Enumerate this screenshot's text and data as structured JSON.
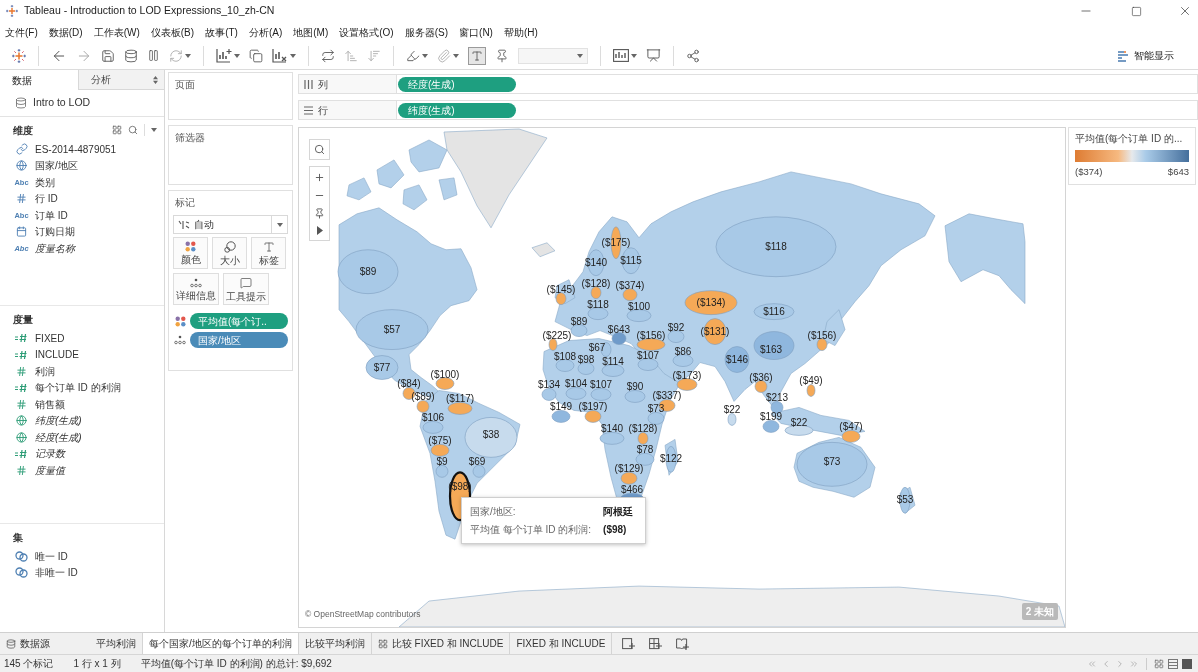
{
  "window": {
    "title": "Tableau - Introduction to LOD Expressions_10_zh-CN"
  },
  "menu": [
    "文件(F)",
    "数据(D)",
    "工作表(W)",
    "仪表板(B)",
    "故事(T)",
    "分析(A)",
    "地图(M)",
    "设置格式(O)",
    "服务器(S)",
    "窗口(N)",
    "帮助(H)"
  ],
  "toolbar": {
    "mark_labels_on": true,
    "show_me": "智能显示"
  },
  "data_pane": {
    "tabs": [
      {
        "label": "数据",
        "selected": true
      },
      {
        "label": "分析",
        "selected": false
      }
    ],
    "source": "Intro to LOD",
    "sections": [
      {
        "title": "维度",
        "kind": "dimension",
        "fields": [
          {
            "name": "ES-2014-4879051",
            "kind": "group",
            "generated": false
          },
          {
            "name": "国家/地区",
            "kind": "geo",
            "generated": false
          },
          {
            "name": "类别",
            "kind": "string",
            "icon_text": "Abc",
            "generated": false
          },
          {
            "name": "行 ID",
            "kind": "number",
            "generated": false
          },
          {
            "name": "订单 ID",
            "kind": "string",
            "icon_text": "Abc",
            "generated": false
          },
          {
            "name": "订购日期",
            "kind": "date",
            "generated": false
          },
          {
            "name": "度量名称",
            "kind": "string",
            "icon_text": "Abc",
            "generated": true
          }
        ]
      },
      {
        "title": "度量",
        "kind": "measure",
        "fields": [
          {
            "name": "FIXED",
            "kind": "calc",
            "generated": false
          },
          {
            "name": "INCLUDE",
            "kind": "calc",
            "generated": false
          },
          {
            "name": "利润",
            "kind": "number",
            "generated": false
          },
          {
            "name": "每个订单 ID 的利润",
            "kind": "calc",
            "generated": false
          },
          {
            "name": "销售额",
            "kind": "number",
            "generated": false
          },
          {
            "name": "纬度(生成)",
            "kind": "geo",
            "generated": true
          },
          {
            "name": "经度(生成)",
            "kind": "geo",
            "generated": true
          },
          {
            "name": "记录数",
            "kind": "calc",
            "generated": true
          },
          {
            "name": "度量值",
            "kind": "number",
            "generated": true
          }
        ]
      },
      {
        "title": "集",
        "kind": "set",
        "fields": [
          {
            "name": "唯一 ID",
            "kind": "set",
            "generated": false
          },
          {
            "name": "非唯一 ID",
            "kind": "set",
            "generated": false
          }
        ]
      }
    ]
  },
  "cards": {
    "pages": {
      "title": "页面"
    },
    "filters": {
      "title": "筛选器"
    },
    "marks": {
      "title": "标记",
      "mark_type": "自动",
      "properties": [
        {
          "label": "颜色",
          "kind": "color"
        },
        {
          "label": "大小",
          "kind": "size"
        },
        {
          "label": "标签",
          "kind": "label"
        },
        {
          "label": "详细信息",
          "kind": "detail"
        },
        {
          "label": "工具提示",
          "kind": "tooltip"
        }
      ],
      "pills": [
        {
          "label": "平均值(每个订..",
          "kind": "color",
          "color": "#1e9f80"
        },
        {
          "label": "国家/地区",
          "kind": "detail",
          "color": "#4a8bb8"
        }
      ]
    }
  },
  "shelves": [
    {
      "label": "列",
      "kind": "columns",
      "pill": {
        "label": "经度(生成)",
        "color": "#1e9f80"
      }
    },
    {
      "label": "行",
      "kind": "rows",
      "pill": {
        "label": "纬度(生成)",
        "color": "#1e9f80"
      }
    }
  ],
  "map": {
    "regions": [
      {
        "kind": "americas",
        "labels": [
          {
            "text": "$89",
            "color": "#a8c9e7",
            "selected": false
          },
          {
            "text": "$57",
            "color": "#a8c9e7",
            "selected": false
          },
          {
            "text": "$77",
            "color": "#a8c9e7",
            "selected": false
          },
          {
            "text": "($84)",
            "color": "#f5a957",
            "selected": false
          },
          {
            "text": "($100)",
            "color": "#f5a957",
            "selected": false
          },
          {
            "text": "($89)",
            "color": "#f5a957",
            "selected": false
          },
          {
            "text": "($117)",
            "color": "#f5a957",
            "selected": false
          },
          {
            "text": "$106",
            "color": "#a8c9e7",
            "selected": false
          },
          {
            "text": "($75)",
            "color": "#f5a957",
            "selected": false
          },
          {
            "text": "$38",
            "color": "#c7dbed",
            "selected": false
          },
          {
            "text": "$9",
            "color": "#a8c9e7",
            "selected": false
          },
          {
            "text": "$69",
            "color": "#a8c9e7",
            "selected": false
          },
          {
            "text": "($98)",
            "color": "#f5a957",
            "selected": true
          }
        ]
      },
      {
        "kind": "europe",
        "labels": [
          {
            "text": "($175)",
            "color": "#f5a957",
            "selected": false
          },
          {
            "text": "$140",
            "color": "#a8c9e7",
            "selected": false
          },
          {
            "text": "$115",
            "color": "#a8c9e7",
            "selected": false
          },
          {
            "text": "($145)",
            "color": "#f5a957",
            "selected": false
          },
          {
            "text": "($128)",
            "color": "#f5a957",
            "selected": false
          },
          {
            "text": "($374)",
            "color": "#f5a957",
            "selected": false
          },
          {
            "text": "$118",
            "color": "#a8c9e7",
            "selected": false
          },
          {
            "text": "$100",
            "color": "#a8c9e7",
            "selected": false
          },
          {
            "text": "$89",
            "color": "#a8c9e7",
            "selected": false
          },
          {
            "text": "($225)",
            "color": "#f5a957",
            "selected": false
          },
          {
            "text": "$643",
            "color": "#6f9bca",
            "selected": false
          },
          {
            "text": "($156)",
            "color": "#f5a957",
            "selected": false
          },
          {
            "text": "$67",
            "color": "#a8c9e7",
            "selected": false
          }
        ]
      },
      {
        "kind": "africa",
        "labels": [
          {
            "text": "$108",
            "color": "#a8c9e7",
            "selected": false
          },
          {
            "text": "$98",
            "color": "#a8c9e7",
            "selected": false
          },
          {
            "text": "$114",
            "color": "#a8c9e7",
            "selected": false
          },
          {
            "text": "$134",
            "color": "#a8c9e7",
            "selected": false
          },
          {
            "text": "$104",
            "color": "#a8c9e7",
            "selected": false
          },
          {
            "text": "$107",
            "color": "#a8c9e7",
            "selected": false
          },
          {
            "text": "$90",
            "color": "#a8c9e7",
            "selected": false
          },
          {
            "text": "$149",
            "color": "#8fb7de",
            "selected": false
          },
          {
            "text": "($197)",
            "color": "#f5a957",
            "selected": false
          },
          {
            "text": "$73",
            "color": "#a8c9e7",
            "selected": false
          },
          {
            "text": "$140",
            "color": "#a8c9e7",
            "selected": false
          },
          {
            "text": "($128)",
            "color": "#f5a957",
            "selected": false
          },
          {
            "text": "$78",
            "color": "#a8c9e7",
            "selected": false
          },
          {
            "text": "($129)",
            "color": "#f5a957",
            "selected": false
          },
          {
            "text": "$122",
            "color": "#a8c9e7",
            "selected": false
          },
          {
            "text": "$466",
            "color": "#6f9bca",
            "selected": false
          }
        ]
      },
      {
        "kind": "asia",
        "labels": [
          {
            "text": "$118",
            "color": "#a8c9e7",
            "selected": false
          },
          {
            "text": "($134)",
            "color": "#f5a957",
            "selected": false
          },
          {
            "text": "$116",
            "color": "#a8c9e7",
            "selected": false
          },
          {
            "text": "$92",
            "color": "#a8c9e7",
            "selected": false
          },
          {
            "text": "($131)",
            "color": "#f5a957",
            "selected": false
          },
          {
            "text": "($156)",
            "color": "#f5a957",
            "selected": false
          },
          {
            "text": "$107",
            "color": "#a8c9e7",
            "selected": false
          },
          {
            "text": "$86",
            "color": "#a8c9e7",
            "selected": false
          },
          {
            "text": "$146",
            "color": "#8fb7de",
            "selected": false
          },
          {
            "text": "$163",
            "color": "#8fb7de",
            "selected": false
          },
          {
            "text": "($173)",
            "color": "#f5a957",
            "selected": false
          },
          {
            "text": "($36)",
            "color": "#f5a957",
            "selected": false
          },
          {
            "text": "($49)",
            "color": "#f5a957",
            "selected": false
          },
          {
            "text": "($337)",
            "color": "#f5a957",
            "selected": false
          },
          {
            "text": "$213",
            "color": "#8fb7de",
            "selected": false
          },
          {
            "text": "$22",
            "color": "#c7dbed",
            "selected": false
          },
          {
            "text": "$199",
            "color": "#8fb7de",
            "selected": false
          },
          {
            "text": "$22",
            "color": "#c7dbed",
            "selected": false
          }
        ]
      },
      {
        "kind": "oceania",
        "labels": [
          {
            "text": "($47)",
            "color": "#f5a957",
            "selected": false
          },
          {
            "text": "$73",
            "color": "#a8c9e7",
            "selected": false
          },
          {
            "text": "$53",
            "color": "#a8c9e7",
            "selected": false
          }
        ]
      }
    ],
    "tooltip": {
      "rows": [
        {
          "label": "国家/地区:",
          "value": "阿根廷"
        },
        {
          "label": "平均值 每个订单 ID 的利润:",
          "value": "($98)"
        }
      ]
    },
    "attribution": "© OpenStreetMap contributors",
    "unknown_badge": "2 未知"
  },
  "legend": {
    "title": "平均值(每个订单 ID 的...",
    "min": "($374)",
    "max": "$643"
  },
  "sheet_tabs": [
    {
      "label": "数据源",
      "kind": "datasource",
      "selected": false
    },
    {
      "label": "平均利润",
      "kind": "sheet",
      "selected": false
    },
    {
      "label": "每个国家/地区的每个订单的利润",
      "kind": "sheet",
      "selected": true
    },
    {
      "label": "比较平均利润",
      "kind": "sheet",
      "selected": false
    },
    {
      "label": "比较 FIXED 和 INCLUDE",
      "kind": "dashboard",
      "selected": false
    },
    {
      "label": "FIXED 和 INCLUDE",
      "kind": "sheet",
      "selected": false
    }
  ],
  "status_bar": [
    "145 个标记",
    "1 行 x 1 列",
    "平均值(每个订单 ID 的利润) 的总计: $9,692"
  ]
}
